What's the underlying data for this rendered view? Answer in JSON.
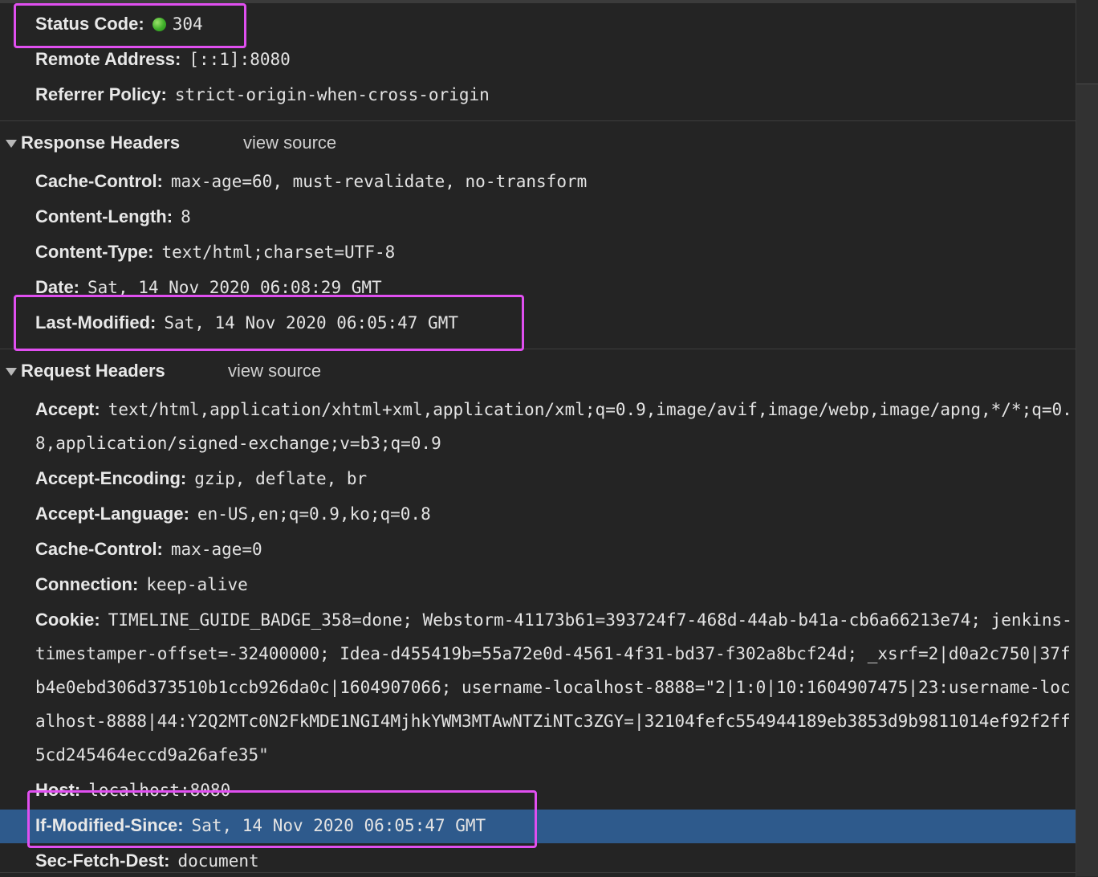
{
  "general": {
    "status_code": {
      "key": "Status Code:",
      "value": "304"
    },
    "remote_address": {
      "key": "Remote Address:",
      "value": "[::1]:8080"
    },
    "referrer_policy": {
      "key": "Referrer Policy:",
      "value": "strict-origin-when-cross-origin"
    }
  },
  "response_headers": {
    "title": "Response Headers",
    "view_source": "view source",
    "items": [
      {
        "key": "Cache-Control:",
        "value": "max-age=60, must-revalidate, no-transform"
      },
      {
        "key": "Content-Length:",
        "value": "8"
      },
      {
        "key": "Content-Type:",
        "value": "text/html;charset=UTF-8"
      },
      {
        "key": "Date:",
        "value": "Sat, 14 Nov 2020 06:08:29 GMT"
      },
      {
        "key": "Last-Modified:",
        "value": "Sat, 14 Nov 2020 06:05:47 GMT"
      }
    ]
  },
  "request_headers": {
    "title": "Request Headers",
    "view_source": "view source",
    "items": [
      {
        "key": "Accept:",
        "value": "text/html,application/xhtml+xml,application/xml;q=0.9,image/avif,image/webp,image/apng,*/*;q=0.8,application/signed-exchange;v=b3;q=0.9"
      },
      {
        "key": "Accept-Encoding:",
        "value": "gzip, deflate, br"
      },
      {
        "key": "Accept-Language:",
        "value": "en-US,en;q=0.9,ko;q=0.8"
      },
      {
        "key": "Cache-Control:",
        "value": "max-age=0"
      },
      {
        "key": "Connection:",
        "value": "keep-alive"
      },
      {
        "key": "Cookie:",
        "value": "TIMELINE_GUIDE_BADGE_358=done; Webstorm-41173b61=393724f7-468d-44ab-b41a-cb6a66213e74; jenkins-timestamper-offset=-32400000; Idea-d455419b=55a72e0d-4561-4f31-bd37-f302a8bcf24d; _xsrf=2|d0a2c750|37fb4e0ebd306d373510b1ccb926da0c|1604907066; username-localhost-8888=\"2|1:0|10:1604907475|23:username-localhost-8888|44:Y2Q2MTc0N2FkMDE1NGI4MjhkYWM3MTAwNTZiNTc3ZGY=|32104fefc554944189eb3853d9b9811014ef92f2ff5cd245464eccd9a26afe35\""
      },
      {
        "key": "Host:",
        "value": "localhost:8080"
      },
      {
        "key": "If-Modified-Since:",
        "value": "Sat, 14 Nov 2020 06:05:47 GMT"
      },
      {
        "key": "Sec-Fetch-Dest:",
        "value": "document"
      }
    ]
  },
  "colors": {
    "background": "#242424",
    "selected_row": "#2e5a8c",
    "annotation_box": "#e04ff0",
    "status_dot": "#3eae29"
  },
  "icons": {
    "status": "green-dot-icon",
    "expand": "triangle-down-icon"
  }
}
